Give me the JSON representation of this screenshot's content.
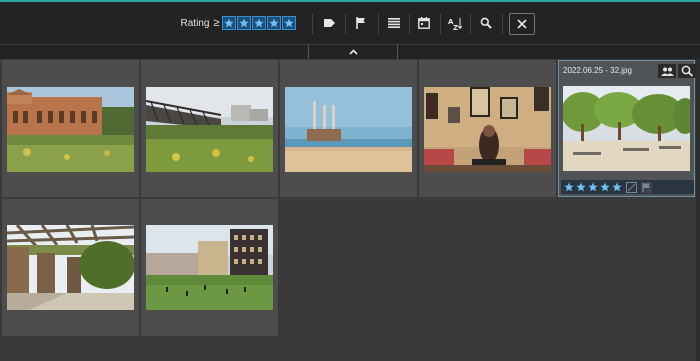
{
  "toolbar": {
    "rating_label": "Rating",
    "rating_operator": "≥",
    "rating_stars": 5,
    "icons": [
      "tag-icon",
      "flag-icon",
      "list-icon",
      "calendar-icon",
      "sort-az-icon",
      "search-icon",
      "close-icon"
    ]
  },
  "photos": [
    {
      "name": "photo-old-factory-building"
    },
    {
      "name": "photo-railway-bridge"
    },
    {
      "name": "photo-chimneys-beach"
    },
    {
      "name": "photo-woman-cafe"
    },
    {
      "name": "photo-park-trees",
      "filename": "2022.06.25 - 32.jpg",
      "rating": 5,
      "selected": true
    },
    {
      "name": "photo-pergola-garden"
    },
    {
      "name": "photo-football-field-buildings"
    }
  ],
  "colors": {
    "accent": "#2aa3a3",
    "star": "#6fb6ea",
    "toolbar": "#232323"
  }
}
